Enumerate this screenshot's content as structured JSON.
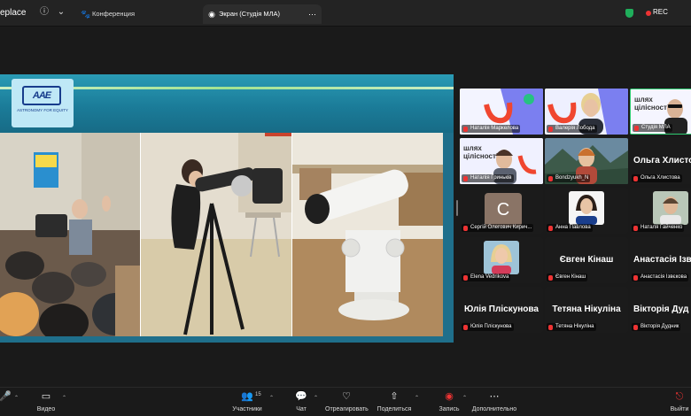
{
  "topbar": {
    "app_name_visible": "eplace",
    "tab_conference": "Конференция",
    "tab_share": "Экран (Студія МЛА)",
    "rec_label": "REC"
  },
  "share": {
    "logo_mark": "AAE",
    "logo_text": "ASTRONOMY FOR EQUITY"
  },
  "gallery": {
    "tiles": [
      {
        "name": "Наталія Маркелова"
      },
      {
        "name": "Валерія Лобода"
      },
      {
        "name": "Студія МЛА"
      },
      {
        "name": "Наталія Гриньків"
      },
      {
        "name": "Bondzyukh_N"
      },
      {
        "name": "Ольга Хлистова",
        "big": "Ольга Хлисто"
      },
      {
        "name": "Сергій Олегович Кирич...",
        "avatar_letter": "С"
      },
      {
        "name": "Анна Павлова"
      },
      {
        "name": "Наталя Гайченко"
      },
      {
        "name": "Elena Vedrikova"
      },
      {
        "name": "Євген Кінаш",
        "big": "Євген Кінаш"
      },
      {
        "name": "Анастасія Ізвєкова",
        "big": "Анастасія Ізв"
      },
      {
        "name": "Юлія Плiскунова",
        "big": "Юлія Плiскунова"
      },
      {
        "name": "Тетяна Нікуліна",
        "big": "Тетяна Нікуліна"
      },
      {
        "name": "Вікторія Дудник",
        "big": "Вікторія Дуд"
      }
    ]
  },
  "toolbar": {
    "video_label": "Видео",
    "participants_label": "Участники",
    "participants_count": "15",
    "chat_label": "Чат",
    "react_label": "Отреагировать",
    "share_label": "Поделиться",
    "record_label": "Запись",
    "more_label": "Дополнительно",
    "leave_label": "Выйти"
  },
  "colors": {
    "accent_green": "#1fae5b",
    "rec_red": "#ee3333",
    "share_teal": "#1b7c99"
  }
}
